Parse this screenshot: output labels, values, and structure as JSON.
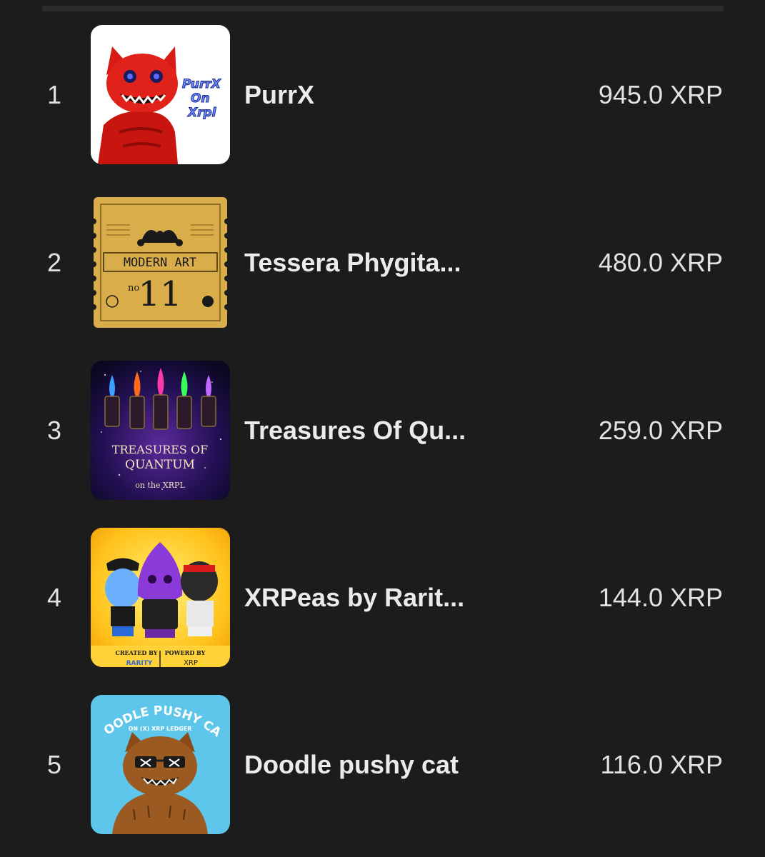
{
  "collections": [
    {
      "rank": "1",
      "name": "PurrX",
      "price": "945.0 XRP",
      "thumbnail_text": [
        "PurrX",
        "On",
        "Xrpl"
      ]
    },
    {
      "rank": "2",
      "name": "Tessera Phygita...",
      "price": "480.0 XRP",
      "thumbnail_text": [
        "MODERN ART",
        "no",
        "11"
      ]
    },
    {
      "rank": "3",
      "name": "Treasures Of Qu...",
      "price": "259.0 XRP",
      "thumbnail_text": [
        "TREASURES OF",
        "QUANTUM",
        "on the XRPL"
      ]
    },
    {
      "rank": "4",
      "name": "XRPeas by Rarit...",
      "price": "144.0 XRP",
      "thumbnail_text": [
        "CREATED BY",
        "POWERD BY",
        "RARITY",
        "XRP"
      ]
    },
    {
      "rank": "5",
      "name": "Doodle pushy cat",
      "price": "116.0 XRP",
      "thumbnail_text": [
        "DOODLE PUSHY CAT",
        "ON (X) XRP LEDGER"
      ]
    }
  ],
  "colors": {
    "background": "#1c1c1c",
    "text": "#e6e6e6"
  }
}
